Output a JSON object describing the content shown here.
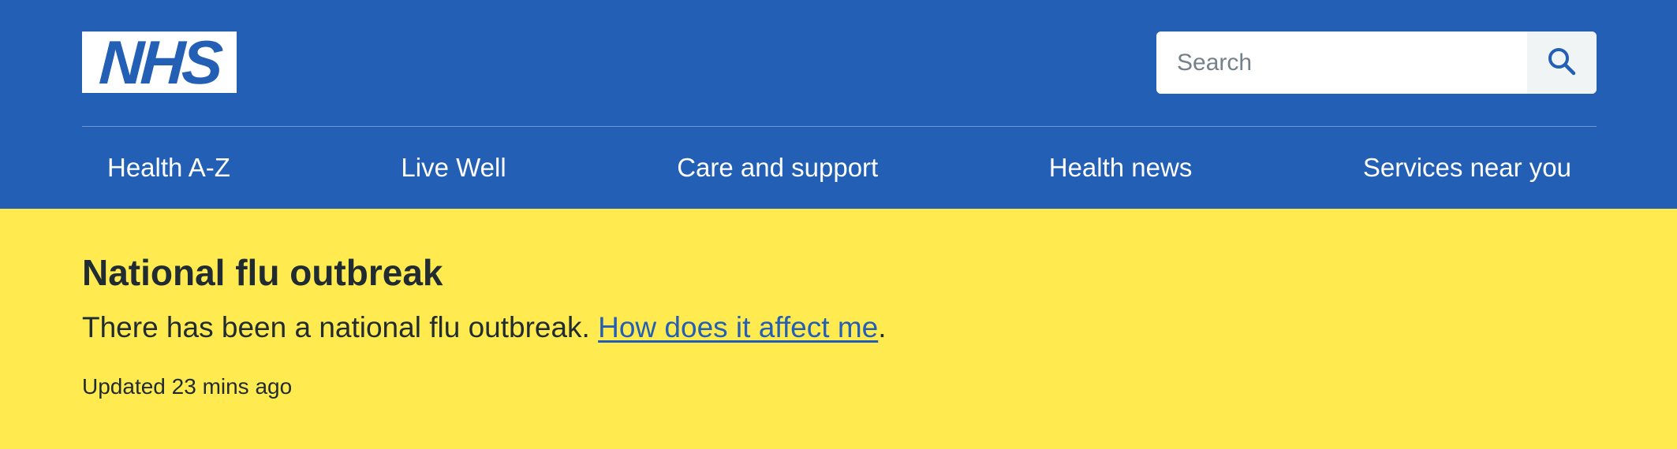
{
  "header": {
    "logo_text": "NHS",
    "logo_color": "#235fb5",
    "background_color": "#235fb5",
    "search": {
      "placeholder": "Search",
      "value": "",
      "button_icon": "search-icon"
    },
    "nav": [
      {
        "label": "Health A-Z"
      },
      {
        "label": "Live Well"
      },
      {
        "label": "Care and support"
      },
      {
        "label": "Health news"
      },
      {
        "label": "Services near you"
      }
    ]
  },
  "alert_banner": {
    "background_color": "#ffeb4f",
    "title": "National flu outbreak",
    "text_before_link": "There has been a national flu outbreak. ",
    "link_text": "How does it affect me",
    "text_after_link": ".",
    "updated": "Updated 23 mins ago"
  }
}
